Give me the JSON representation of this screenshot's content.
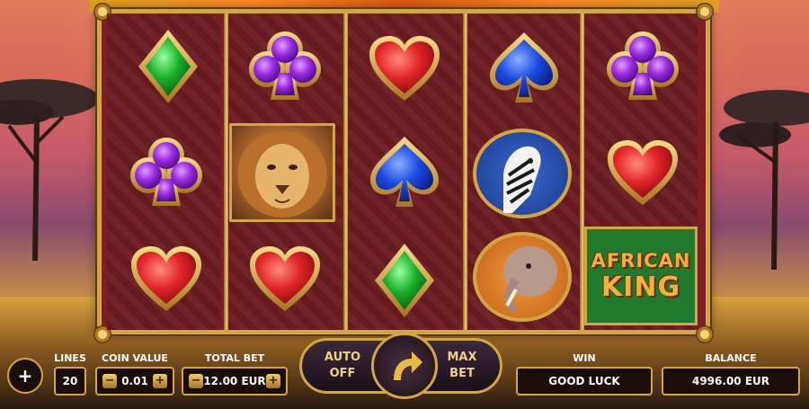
{
  "colors": {
    "gold": "#d4a642",
    "reel_bg": "#6b1c22",
    "logo_green": "#1f7a2e"
  },
  "reels": [
    [
      "diamond-green",
      "club-purple",
      "heart-red"
    ],
    [
      "club-purple",
      "lion",
      "heart-red"
    ],
    [
      "heart-red",
      "spade-blue",
      "diamond-green"
    ],
    [
      "spade-blue",
      "zebra",
      "elephant"
    ],
    [
      "club-purple",
      "heart-red",
      "african-king-logo"
    ]
  ],
  "logo": {
    "line1": "AFRICAN",
    "line2": "KING"
  },
  "controls": {
    "menu_icon": "plus",
    "lines": {
      "label": "LINES",
      "value": "20"
    },
    "coin_value": {
      "label": "COIN VALUE",
      "value": "0.01",
      "minus": "−",
      "plus": "+"
    },
    "total_bet": {
      "label": "TOTAL BET",
      "value": "12.00 EUR",
      "minus": "−",
      "plus": "+"
    },
    "auto": {
      "line1": "AUTO",
      "line2": "OFF"
    },
    "spin_icon": "curved-arrow-icon",
    "max_bet": {
      "line1": "MAX",
      "line2": "BET"
    },
    "win": {
      "label": "WIN",
      "value": "GOOD LUCK"
    },
    "balance": {
      "label": "BALANCE",
      "value": "4996.00 EUR"
    }
  }
}
